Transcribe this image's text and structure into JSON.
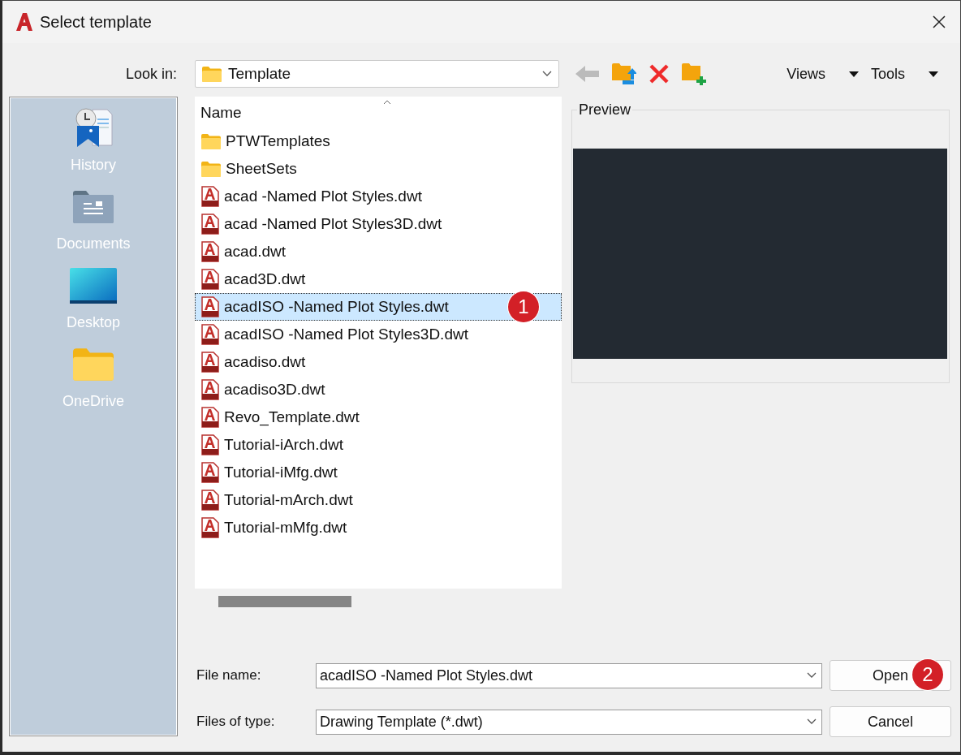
{
  "window": {
    "title": "Select template"
  },
  "look_in": {
    "label": "Look in:",
    "value": "Template"
  },
  "toolbar": {
    "views": "Views",
    "tools": "Tools"
  },
  "places": [
    {
      "label": "History",
      "kind": "history"
    },
    {
      "label": "Documents",
      "kind": "documents"
    },
    {
      "label": "Desktop",
      "kind": "desktop"
    },
    {
      "label": "OneDrive",
      "kind": "folder"
    }
  ],
  "file_list": {
    "column": "Name",
    "items": [
      {
        "name": "PTWTemplates",
        "kind": "folder",
        "selected": false
      },
      {
        "name": "SheetSets",
        "kind": "folder",
        "selected": false
      },
      {
        "name": "acad -Named Plot Styles.dwt",
        "kind": "dwt",
        "selected": false
      },
      {
        "name": "acad -Named Plot Styles3D.dwt",
        "kind": "dwt",
        "selected": false
      },
      {
        "name": "acad.dwt",
        "kind": "dwt",
        "selected": false
      },
      {
        "name": "acad3D.dwt",
        "kind": "dwt",
        "selected": false
      },
      {
        "name": "acadISO -Named Plot Styles.dwt",
        "kind": "dwt",
        "selected": true,
        "callout": "1"
      },
      {
        "name": "acadISO -Named Plot Styles3D.dwt",
        "kind": "dwt",
        "selected": false
      },
      {
        "name": "acadiso.dwt",
        "kind": "dwt",
        "selected": false
      },
      {
        "name": "acadiso3D.dwt",
        "kind": "dwt",
        "selected": false
      },
      {
        "name": "Revo_Template.dwt",
        "kind": "dwt",
        "selected": false
      },
      {
        "name": "Tutorial-iArch.dwt",
        "kind": "dwt",
        "selected": false
      },
      {
        "name": "Tutorial-iMfg.dwt",
        "kind": "dwt",
        "selected": false
      },
      {
        "name": "Tutorial-mArch.dwt",
        "kind": "dwt",
        "selected": false
      },
      {
        "name": "Tutorial-mMfg.dwt",
        "kind": "dwt",
        "selected": false
      }
    ]
  },
  "preview": {
    "label": "Preview"
  },
  "file_name": {
    "label": "File name:",
    "value": "acadISO -Named Plot Styles.dwt"
  },
  "file_type": {
    "label": "Files of type:",
    "value": "Drawing Template (*.dwt)"
  },
  "buttons": [
    {
      "label": "Open",
      "callout": "2"
    },
    {
      "label": "Cancel"
    }
  ]
}
